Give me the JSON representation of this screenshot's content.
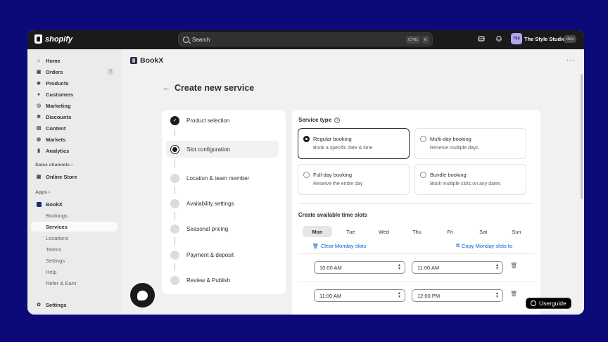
{
  "topbar": {
    "brand": "shopify",
    "search_placeholder": "Search",
    "shortcut_key1": "CTRL",
    "shortcut_key2": "K",
    "store_initials": "TSS",
    "store_name": "The Style Studio",
    "env_badge": "dev"
  },
  "sidebar": {
    "items": [
      {
        "label": "Home",
        "icon": "home-icon"
      },
      {
        "label": "Orders",
        "icon": "orders-icon",
        "count": "3"
      },
      {
        "label": "Products",
        "icon": "tag-icon"
      },
      {
        "label": "Customers",
        "icon": "person-icon"
      },
      {
        "label": "Marketing",
        "icon": "target-icon"
      },
      {
        "label": "Discounts",
        "icon": "discount-icon"
      },
      {
        "label": "Content",
        "icon": "content-icon"
      },
      {
        "label": "Markets",
        "icon": "globe-icon"
      },
      {
        "label": "Analytics",
        "icon": "chart-icon"
      }
    ],
    "sales_channels_label": "Sales channels",
    "online_store": "Online Store",
    "apps_label": "Apps",
    "app_name": "BookX",
    "app_subitems": [
      "Bookings",
      "Services",
      "Locations",
      "Teams",
      "Settings",
      "Help",
      "Refer & Earn"
    ],
    "active_subitem": "Services",
    "settings_label": "Settings"
  },
  "main": {
    "app_title": "BookX",
    "page_title": "Create new service",
    "steps": [
      {
        "label": "Product selection",
        "state": "done"
      },
      {
        "label": "Slot configuration",
        "state": "current"
      },
      {
        "label": "Location & team member",
        "state": "todo"
      },
      {
        "label": "Availability settings",
        "state": "todo"
      },
      {
        "label": "Seasonal pricing",
        "state": "todo"
      },
      {
        "label": "Payment & deposit",
        "state": "todo"
      },
      {
        "label": "Review & Publish",
        "state": "todo"
      }
    ],
    "service_type_label": "Service type",
    "service_types": [
      {
        "title": "Regular booking",
        "desc": "Book a specific date & time",
        "selected": true
      },
      {
        "title": "Multi-day booking",
        "desc": "Reserve multiple days",
        "selected": false
      },
      {
        "title": "Full-day booking",
        "desc": "Reserve the entire day",
        "selected": false
      },
      {
        "title": "Bundle booking",
        "desc": "Book multiple slots on any dates",
        "selected": false
      }
    ],
    "slots_title": "Create available time slots",
    "days": [
      "Mon",
      "Tue",
      "Wed",
      "Thu",
      "Fri",
      "Sat",
      "Sun"
    ],
    "active_day": "Mon",
    "clear_link": "Clear Monday slots",
    "copy_link": "Copy Monday slots to",
    "slots": [
      {
        "start": "10:00 AM",
        "end": "11:00 AM"
      },
      {
        "start": "11:00 AM",
        "end": "12:00 PM"
      }
    ]
  },
  "userguide_label": "Userguide"
}
